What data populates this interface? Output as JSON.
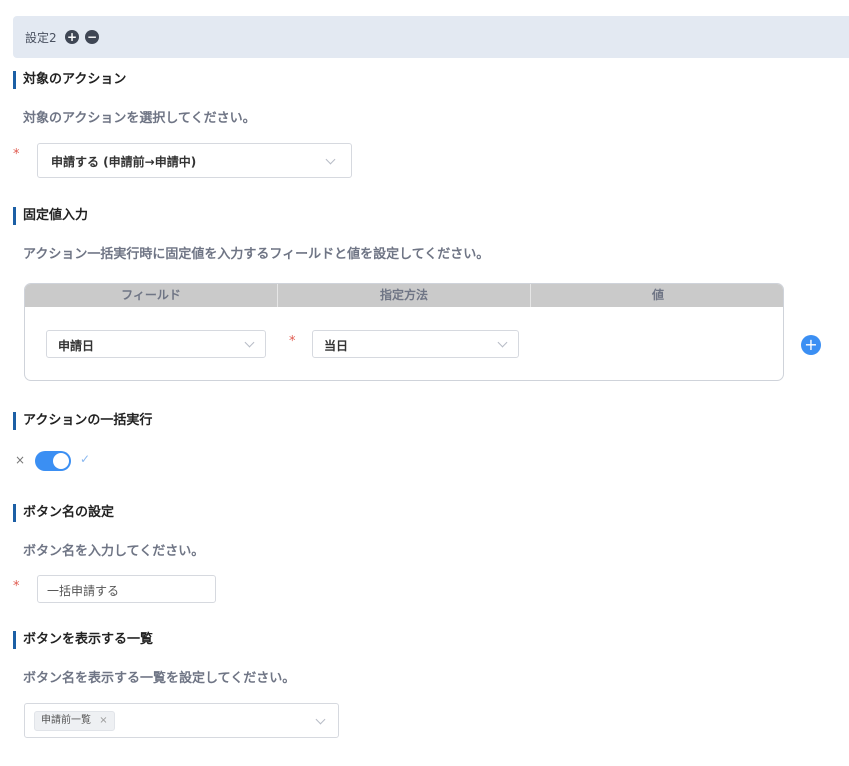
{
  "setting": {
    "title": "設定2",
    "add_icon": "+",
    "remove_icon": "−"
  },
  "target_action": {
    "title": "対象のアクション",
    "description": "対象のアクションを選択してください。",
    "required_mark": "*",
    "selected": "申請する (申請前→申請中)"
  },
  "fixed_value": {
    "title": "固定値入力",
    "description": "アクション一括実行時に固定値を入力するフィールドと値を設定してください。",
    "columns": [
      "フィールド",
      "指定方法",
      "値"
    ],
    "rows": [
      {
        "field": "申請日",
        "required_mark": "*",
        "method": "当日"
      }
    ],
    "add_row_icon": "+"
  },
  "bulk_execute": {
    "title": "アクションの一括実行",
    "off_icon": "×",
    "on_icon": "✓",
    "enabled": true
  },
  "button_name": {
    "title": "ボタン名の設定",
    "description": "ボタン名を入力してください。",
    "required_mark": "*",
    "value": "一括申請する"
  },
  "button_list": {
    "title": "ボタンを表示する一覧",
    "description": "ボタン名を表示する一覧を設定してください。",
    "tags": [
      {
        "label": "申請前一覧",
        "remove_icon": "×"
      }
    ]
  }
}
